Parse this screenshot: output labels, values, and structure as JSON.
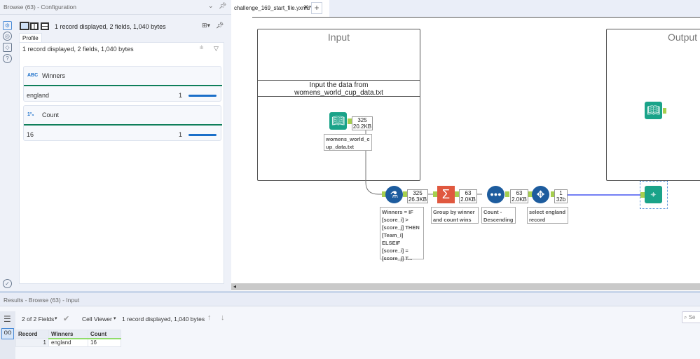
{
  "config_panel": {
    "title": "Browse (63) - Configuration",
    "status": "1 record displayed, 2 fields, 1,040 bytes",
    "tab": "Profile",
    "summary": "1 record displayed, 2 fields, 1,040 bytes",
    "fields": [
      {
        "name": "Winners",
        "type_icon": "string-type-icon",
        "value": "england",
        "count": "1",
        "fill": 1.0
      },
      {
        "name": "Count",
        "type_icon": "number-type-icon",
        "value": "16",
        "count": "1",
        "fill": 1.0
      }
    ]
  },
  "canvas": {
    "tab_label": "challenge_169_start_file.yxmd*",
    "containers": [
      {
        "title": "Input",
        "annotation": "Input the data from womens_world_cup_data.txt"
      },
      {
        "title": "Output"
      }
    ],
    "tools": [
      {
        "name": "input-data",
        "label": "womens_world_cup_data.txt",
        "records": "325",
        "size": "20.2KB",
        "color": "#1aa389"
      },
      {
        "name": "formula",
        "label": "Winners = IF [score_i] > [score_j] THEN [Team_i] ELSEIF [score_i] = [score_j] T...",
        "records": "325",
        "size": "26.3KB",
        "color": "#1d5c9e"
      },
      {
        "name": "summarize",
        "label": "Group by winner and count wins",
        "records": "63",
        "size": "2.0KB",
        "color": "#e0583f"
      },
      {
        "name": "sort",
        "label": "Count - Descending",
        "records": "63",
        "size": "2.0KB",
        "color": "#1d5c9e"
      },
      {
        "name": "select",
        "label": "select england record",
        "records": "1",
        "size": "32b",
        "color": "#1d5c9e"
      },
      {
        "name": "browse",
        "color": "#1aa389"
      },
      {
        "name": "output-data",
        "color": "#1aa389"
      }
    ]
  },
  "results": {
    "title": "Results - Browse (63) - Input",
    "fields_selector": "2 of 2 Fields",
    "viewer": "Cell Viewer",
    "status": "1 record displayed, 1,040 bytes",
    "search_placeholder": "Se",
    "columns": [
      "Record",
      "Winners",
      "Count"
    ],
    "rows": [
      [
        "1",
        "england",
        "16"
      ]
    ]
  }
}
